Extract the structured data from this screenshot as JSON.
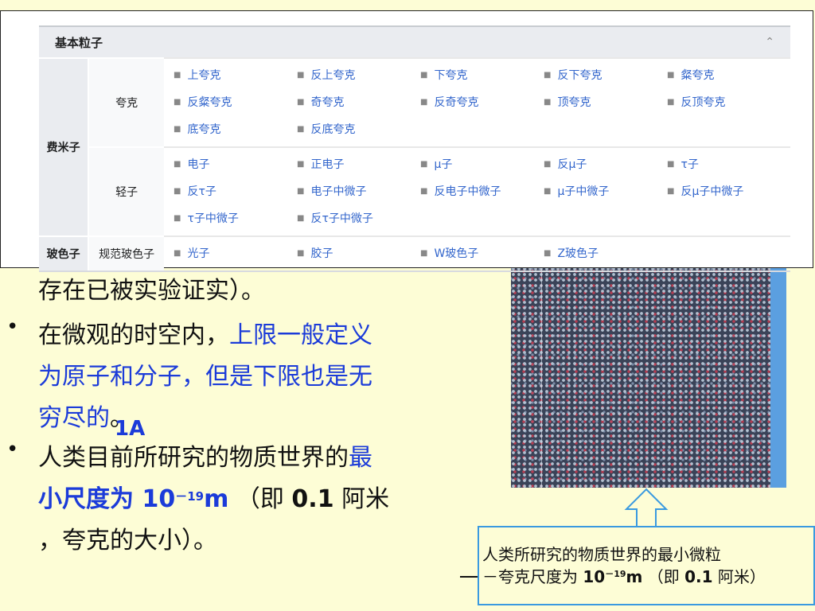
{
  "navbox": {
    "title": "基本粒子",
    "collapse_icon": "chevron-up-icon",
    "fermion_label": "费米子",
    "quark": {
      "label": "夸克",
      "items": [
        "上夸克",
        "反上夸克",
        "下夸克",
        "反下夸克",
        "粲夸克",
        "反粲夸克",
        "奇夸克",
        "反奇夸克",
        "顶夸克",
        "反顶夸克",
        "底夸克",
        "反底夸克"
      ]
    },
    "lepton": {
      "label": "轻子",
      "items": [
        "电子",
        "正电子",
        "μ子",
        "反μ子",
        "τ子",
        "反τ子",
        "电子中微子",
        "反电子中微子",
        "μ子中微子",
        "反μ子中微子",
        "τ子中微子",
        "反τ子中微子"
      ]
    },
    "boson": {
      "label": "玻色子",
      "sub_label": "规范玻色子",
      "items": [
        "光子",
        "胶子",
        "W玻色子",
        "Z玻色子"
      ]
    }
  },
  "slide": {
    "line0": "存在已被实验证实）。",
    "bullet1": {
      "a": "在微观的时空内，",
      "b": "上限一般定义",
      "c": "为原子和分子，但是下限也是无",
      "d": "穷尽的",
      "e": "。",
      "note": "1A"
    },
    "bullet2": {
      "a": "人类目前所研究的物质世界的",
      "b": "最",
      "c": "小尺度为 10",
      "d": "－19",
      "e": "m",
      "f": " （即 ",
      "g": "0.1",
      "h": " 阿米",
      "i": "，夸克的大小）。"
    },
    "bullet_symbol": "•"
  },
  "callout": {
    "line1": "人类所研究的物质世界的最小微粒",
    "line2a": "－夸克尺度为 ",
    "line2b": "10",
    "line2c": "－19",
    "line2d": "m",
    "line2e": " （即 ",
    "line2f": "0.1",
    "line2g": " 阿米）"
  },
  "colors": {
    "slide_background": "#fdfdd6",
    "highlight_blue": "#1b3bd9",
    "link_blue": "#3366cc",
    "callout_border": "#3a9ae0"
  }
}
